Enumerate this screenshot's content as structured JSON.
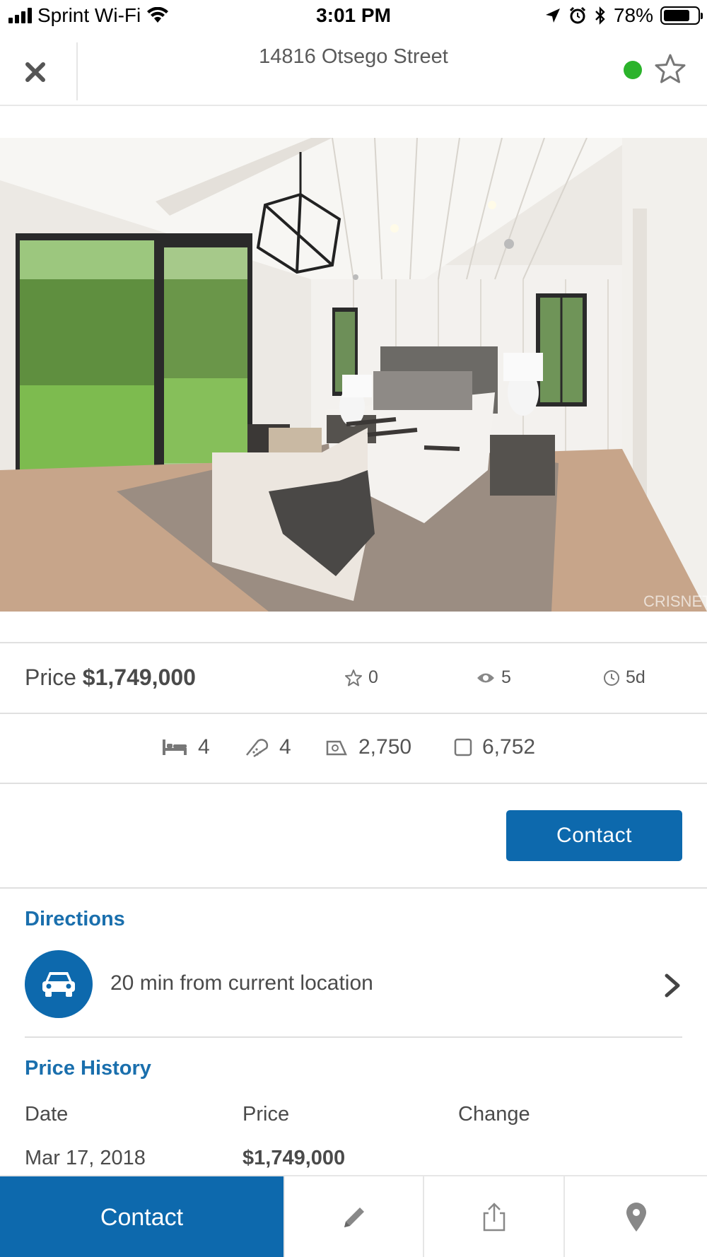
{
  "status_bar": {
    "carrier": "Sprint Wi-Fi",
    "time": "3:01 PM",
    "battery": "78%",
    "battery_level": 0.78
  },
  "header": {
    "title": "14816 Otsego Street",
    "online_indicator_color": "#2bb32b"
  },
  "listing": {
    "price_label": "Price",
    "price_value": "$1,749,000",
    "favorites": "0",
    "views": "5",
    "age": "5d",
    "beds": "4",
    "baths": "4",
    "living_sqft": "2,750",
    "lot_sqft": "6,752",
    "photo_watermark": "CRISNET"
  },
  "actions": {
    "contact_label": "Contact"
  },
  "directions": {
    "title": "Directions",
    "text": "20 min from current location"
  },
  "price_history": {
    "title": "Price History",
    "columns": [
      "Date",
      "Price",
      "Change"
    ],
    "rows": [
      {
        "date": "Mar 17, 2018",
        "price": "$1,749,000",
        "change": ""
      }
    ]
  },
  "bottom_bar": {
    "contact_label": "Contact",
    "icons": [
      "pencil-icon",
      "share-icon",
      "map-pin-icon"
    ]
  },
  "colors": {
    "accent": "#0d69ad",
    "section_title": "#1a6fad",
    "text": "#4a4a4a"
  }
}
